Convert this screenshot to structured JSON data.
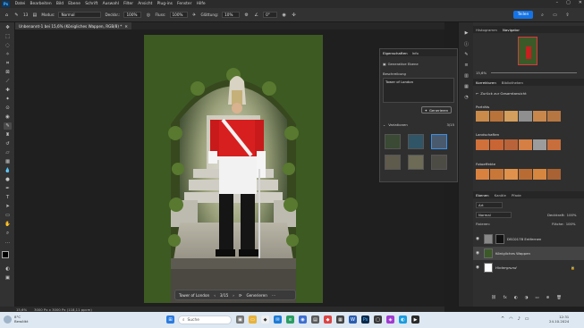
{
  "menu": {
    "logo": "Ps",
    "items": [
      "Datei",
      "Bearbeiten",
      "Bild",
      "Ebene",
      "Schrift",
      "Auswahl",
      "Filter",
      "Ansicht",
      "Plug-ins",
      "Fenster",
      "Hilfe"
    ]
  },
  "options": {
    "brush_size": "13",
    "mode_label": "Modus:",
    "mode_value": "Normal",
    "opacity_label": "Deckkr.:",
    "opacity_value": "100%",
    "flow_label": "Fluss:",
    "flow_value": "100%",
    "smoothing_label": "Glättung:",
    "smoothing_value": "10%",
    "angle_value": "0°",
    "share_label": "Teilen"
  },
  "document": {
    "tab_title": "Unbenannt-1 bei 15,6% (Königliches Wappen, RGB/8) *",
    "status_zoom": "15,6%",
    "status_info": "3000 Px x 3000 Px (118,11 ppcm)"
  },
  "context_bar": {
    "prompt": "Tower of London",
    "counter": "3/15",
    "generate_label": "Generieren"
  },
  "properties": {
    "tab1": "Eigenschaften",
    "tab2": "Info",
    "title": "Generative Ebene",
    "desc_label": "Beschreibung",
    "desc_value": "Tower of London",
    "generate_label": "Generieren",
    "variants_label": "Variationen",
    "variants_count": "3/15"
  },
  "right": {
    "nav_tab1": "Histogramm",
    "nav_tab2": "Navigator",
    "nav_zoom": "15,6%",
    "adj_tab1": "Korrekturen",
    "adj_tab2": "Bibliotheken",
    "back_label": "Zurück zur Gesamtansicht",
    "section1": "Porträts",
    "section2": "Landschaften",
    "section3": "Fotoeffekte",
    "layers_tab1": "Ebenen",
    "layers_tab2": "Kanäle",
    "layers_tab3": "Pfade",
    "kind_label": "Art",
    "blend_mode": "Normal",
    "opacity_label": "Deckkraft:",
    "opacity_value": "100%",
    "lock_label": "Fixieren:",
    "fill_label": "Fläche:",
    "fill_value": "100%",
    "layers": [
      "DSC0178 Entfernen",
      "Königliches Wappen",
      "Hintergrund"
    ]
  },
  "taskbar": {
    "weather_temp": "8°C",
    "weather_text": "Bewölkt",
    "search_placeholder": "Suche",
    "time": "12:31",
    "date": "24.10.2024"
  }
}
